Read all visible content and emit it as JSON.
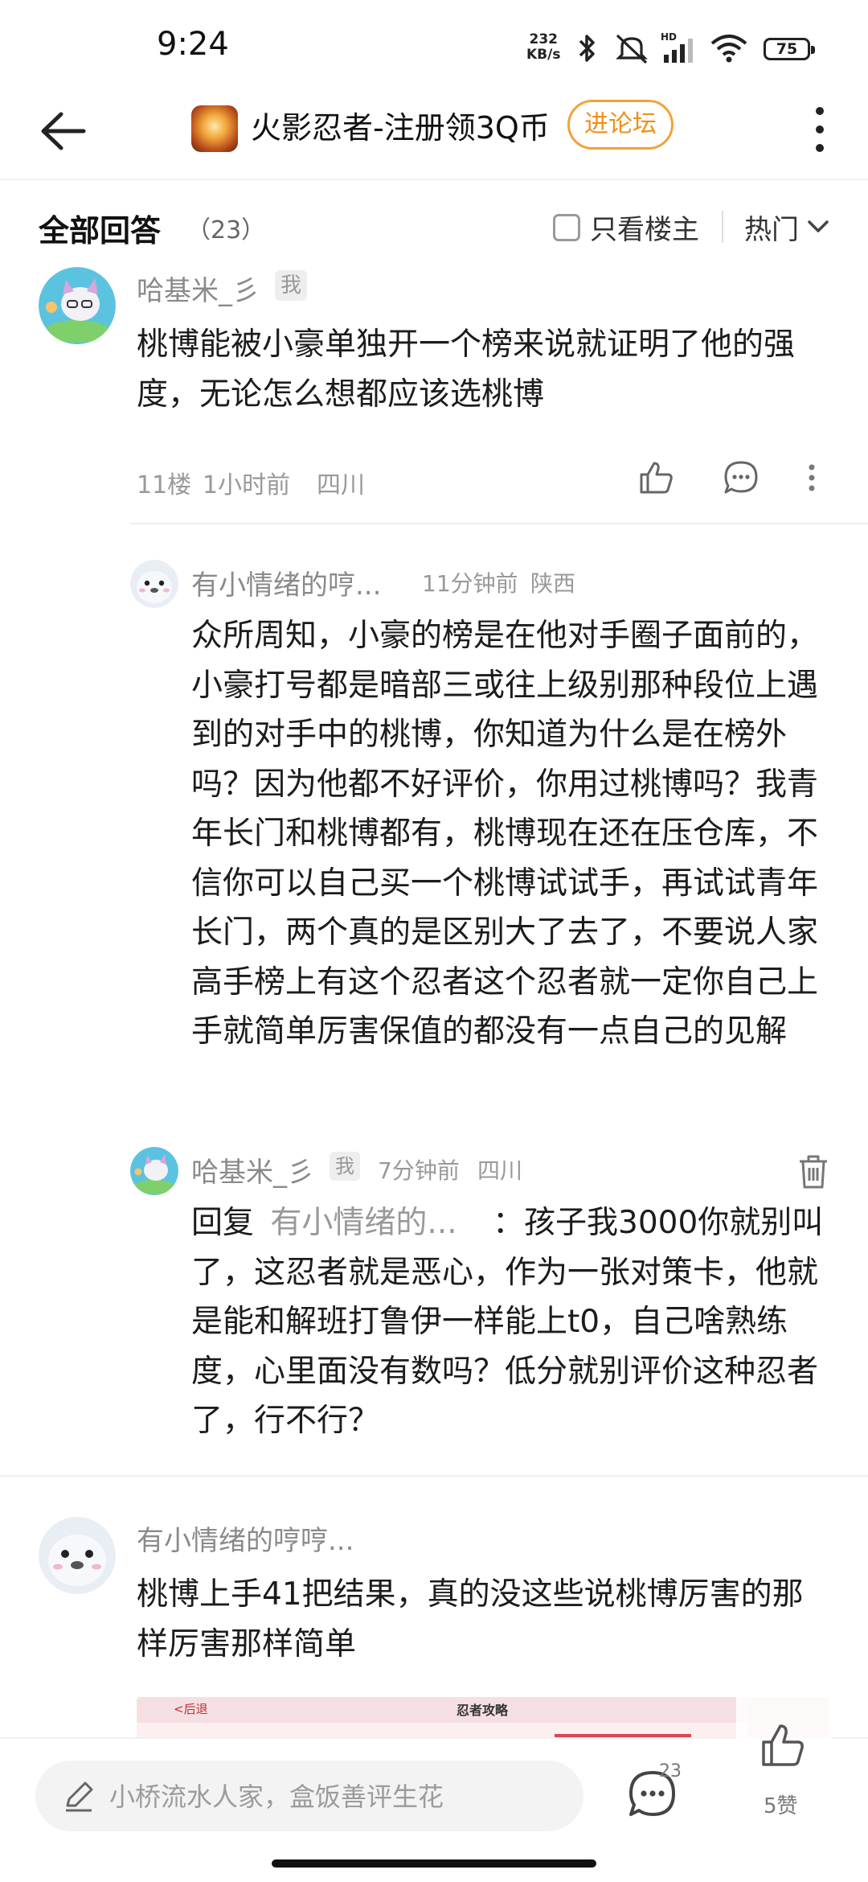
{
  "status_bar": {
    "time": "9:24",
    "net_speed_value": "232",
    "net_speed_unit": "KB/s",
    "battery": "75",
    "icons": [
      "bluetooth-icon",
      "mute-icon",
      "signal-icon",
      "wifi-icon",
      "battery-icon"
    ]
  },
  "nav": {
    "title": "火影忍者-注册领3Q币",
    "forum_button": "进论坛"
  },
  "answers_header": {
    "title": "全部回答",
    "count": "（23）",
    "only_op": "只看楼主",
    "sort": "热门"
  },
  "comments": [
    {
      "name": "哈基米_彡",
      "me_tag": "我",
      "text": "桃博能被小豪单独开一个榜来说就证明了他的强度，无论怎么想都应该选桃博",
      "floor": "11楼",
      "time": "1小时前",
      "location": "四川",
      "replies": [
        {
          "name": "有小情绪的哼...",
          "time": "11分钟前",
          "location": "陕西",
          "text": "众所周知，小豪的榜是在他对手圈子面前的，小豪打号都是暗部三或往上级别那种段位上遇到的对手中的桃博，你知道为什么是在榜外吗？因为他都不好评价，你用过桃博吗？我青年长门和桃博都有，桃博现在还在压仓库，不信你可以自己买一个桃博试试手，再试试青年长门，两个真的是区别大了去了，不要说人家高手榜上有这个忍者这个忍者就一定你自己上手就简单厉害保值的都没有一点自己的见解"
        },
        {
          "name": "哈基米_彡",
          "me_tag": "我",
          "time": "7分钟前",
          "location": "四川",
          "reply_prefix": "回复",
          "reply_to": "有小情绪的...",
          "colon": "：",
          "text": "孩子我3000你就别叫了，这忍者就是恶心，作为一张对策卡，他就是能和解班打鲁伊一样能上t0，自己啥熟练度，心里面没有数吗？低分就别评价这种忍者了，行不行？"
        }
      ]
    },
    {
      "name": "有小情绪的哼哼...",
      "text": "桃博上手41把结果，真的没这些说桃博厉害的那样厉害那样简单",
      "image": {
        "back_label": "<后退",
        "title": "忍者攻略"
      }
    }
  ],
  "bottom_bar": {
    "placeholder": "小桥流水人家，盒饭善评生花",
    "comment_count": "23",
    "likes": "5赞"
  },
  "colors": {
    "accent_orange": "#f2a23a",
    "text_primary": "#1c1c1c",
    "text_meta": "#999999"
  }
}
